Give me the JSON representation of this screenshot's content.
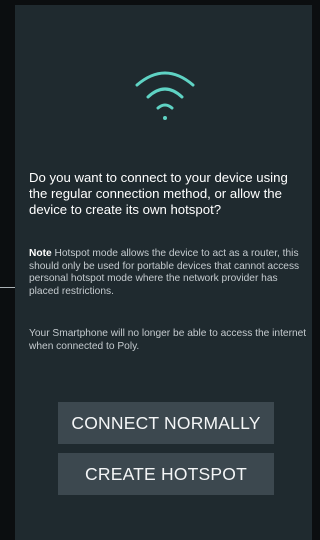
{
  "dialog": {
    "question": "Do you want to connect to your device using the regular connection method, or allow the device to create its own hotspot?",
    "note_label": "Note",
    "note_text": " Hotspot mode allows the device to act as a router, this should only be used for portable devices that cannot access personal hotspot mode where the network provider has placed restrictions.",
    "info_text": "Your Smartphone will no longer be able to access the internet when connected to Poly.",
    "wifi_icon": "wifi-icon"
  },
  "buttons": {
    "connect_normally": "CONNECT NORMALLY",
    "create_hotspot": "CREATE HOTSPOT"
  },
  "colors": {
    "panel_background": "#1f2a2f",
    "wifi_accent": "#5fd3c4",
    "button_background": "#3c484f"
  }
}
